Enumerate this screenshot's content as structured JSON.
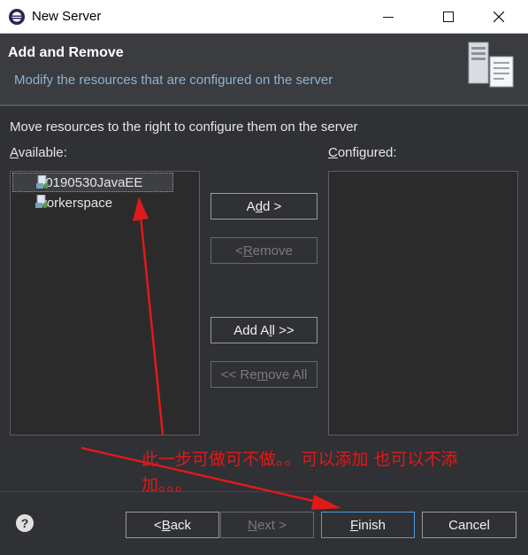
{
  "window": {
    "title": "New Server"
  },
  "header": {
    "title": "Add and Remove",
    "subtitle": "Modify the resources that are configured on the server"
  },
  "instruction": "Move resources to the right to configure them on the server",
  "available": {
    "label_prefix": "",
    "label_mnemonic": "A",
    "label_rest": "vailable:",
    "items": [
      {
        "label": "20190530JavaEE",
        "selected": true
      },
      {
        "label": "workerspace",
        "selected": false
      }
    ]
  },
  "configured": {
    "label_mnemonic": "C",
    "label_rest": "onfigured:"
  },
  "buttons": {
    "add": {
      "pre": "A",
      "mn": "d",
      "post": "d >"
    },
    "remove": {
      "pre": "< ",
      "mn": "R",
      "post": "emove"
    },
    "add_all": {
      "pre": "Add A",
      "mn": "l",
      "post": "l >>"
    },
    "remove_all": {
      "pre": "<< Re",
      "mn": "m",
      "post": "ove All"
    },
    "back": {
      "pre": "< ",
      "mn": "B",
      "post": "ack"
    },
    "next": {
      "pre": "",
      "mn": "N",
      "post": "ext >"
    },
    "finish": {
      "pre": "",
      "mn": "F",
      "post": "inish"
    },
    "cancel": {
      "label": "Cancel"
    }
  },
  "annotation": {
    "text": "此一步可做可不做。。可以添加  也可以不添加。。。",
    "color": "#e0191b"
  },
  "colors": {
    "background": "#2f3134",
    "header": "#3a3c40",
    "subtitle": "#8fb3cf",
    "annotation": "#e0191b"
  },
  "icons": [
    "eclipse-app-icon",
    "minimize-icon",
    "maximize-icon",
    "close-icon",
    "server-banner-icon",
    "project-icon",
    "help-icon"
  ]
}
